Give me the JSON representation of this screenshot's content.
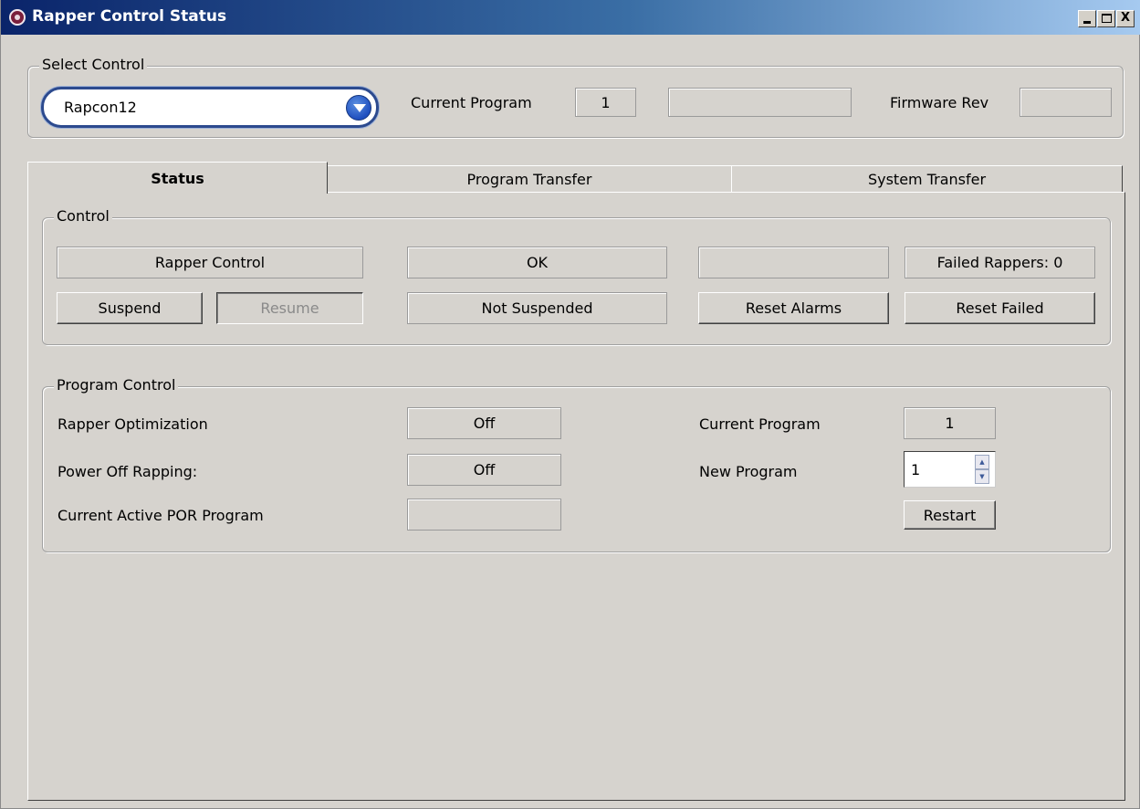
{
  "window": {
    "title": "Rapper Control Status",
    "buttons": {
      "minimize": "_",
      "maximize": "□",
      "close": "X"
    }
  },
  "select_control": {
    "group_title": "Select Control",
    "selected": "Rapcon12",
    "current_program_label": "Current Program",
    "current_program_value": "1",
    "current_program_name": "",
    "firmware_rev_label": "Firmware Rev",
    "firmware_rev_value": ""
  },
  "tabs": [
    {
      "label": "Status",
      "active": true
    },
    {
      "label": "Program Transfer",
      "active": false
    },
    {
      "label": "System Transfer",
      "active": false
    }
  ],
  "control": {
    "group_title": "Control",
    "rapper_control": "Rapper Control",
    "status_ok": "OK",
    "blank_status": "",
    "failed_rappers": "Failed Rappers: 0",
    "suspend_button": "Suspend",
    "resume_button": "Resume",
    "suspend_state": "Not Suspended",
    "reset_alarms_button": "Reset Alarms",
    "reset_failed_button": "Reset Failed"
  },
  "program_control": {
    "group_title": "Program Control",
    "rapper_optimization_label": "Rapper Optimization",
    "rapper_optimization_value": "Off",
    "power_off_rapping_label": "Power Off Rapping:",
    "power_off_rapping_value": "Off",
    "current_active_por_label": "Current Active POR Program",
    "current_active_por_value": "",
    "current_program_label": "Current Program",
    "current_program_value": "1",
    "new_program_label": "New Program",
    "new_program_value": "1",
    "restart_button": "Restart"
  },
  "icons": {
    "app": "app-icon",
    "combo_arrow": "chevron-down-icon",
    "spin_up": "arrow-up-icon",
    "spin_down": "arrow-down-icon"
  }
}
